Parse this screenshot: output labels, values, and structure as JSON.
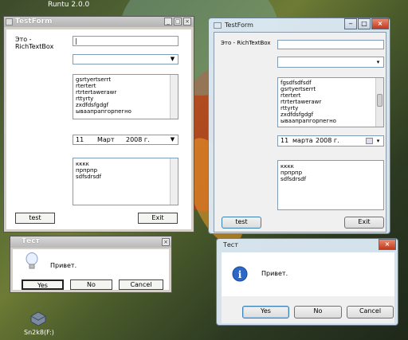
{
  "desktop": {
    "runtime_label": "Runtu 2.0.0",
    "drive_label": "Sn2k8(F:)"
  },
  "left_form": {
    "title": "TestForm",
    "rtb_label_line1": "Это -",
    "rtb_label_line2": "RichTextBox",
    "text_value": "|",
    "combo_value": "",
    "list_items": [
      "gsrtyertserrt",
      "rtertert",
      "rtrtertawerawr",
      "rttyrty",
      "zxdfdsfgdgf",
      "ываапрапгорпегно"
    ],
    "date_day": "11",
    "date_month": "Март",
    "date_year": "2008 г.",
    "rich_lines": [
      "кккк",
      "прпрпр",
      "sdfsdrsdf"
    ],
    "test_button": "test",
    "exit_button": "Exit"
  },
  "left_msgbox": {
    "title": "Тест",
    "message": "Привет.",
    "yes": "Yes",
    "no": "No",
    "cancel": "Cancel"
  },
  "right_form": {
    "title": "TestForm",
    "rtb_label": "Это - RichTextBox",
    "text_value": "",
    "combo_value": "",
    "list_items": [
      "fgsdfsdfsdf",
      "gsrtyertserrt",
      "rtertert",
      "rtrtertawerawr",
      "rttyrty",
      "zxdfdsfgdgf",
      "ываапрапгорпегно"
    ],
    "date_day": "11",
    "date_month": "марта",
    "date_year": "2008 г.",
    "rich_lines": [
      "кккк",
      "прпрпр",
      "sdfsdrsdf"
    ],
    "test_button": "test",
    "exit_button": "Exit"
  },
  "right_msgbox": {
    "title": "Тест",
    "message": "Привет.",
    "yes": "Yes",
    "no": "No",
    "cancel": "Cancel"
  }
}
